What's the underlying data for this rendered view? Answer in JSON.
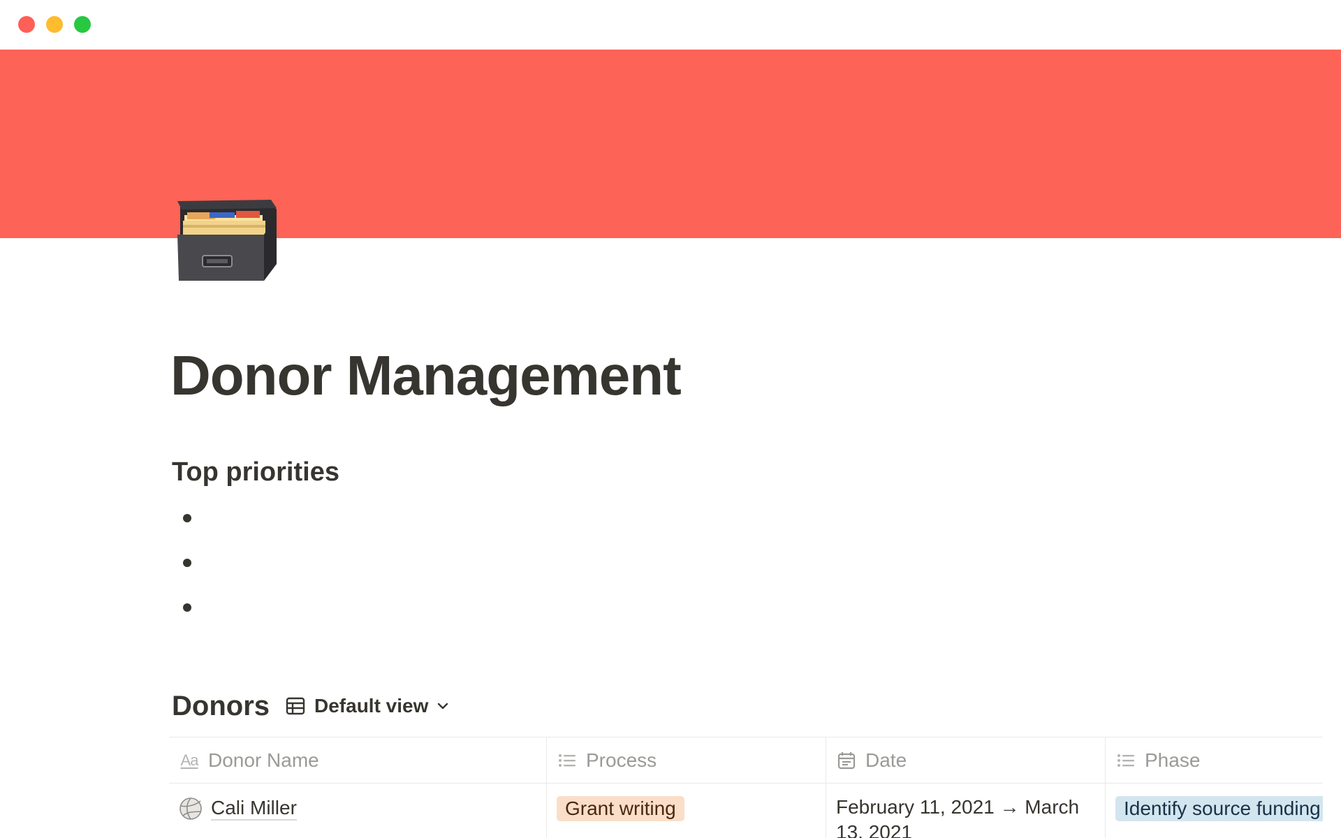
{
  "page": {
    "title": "Donor Management",
    "cover_color": "#fd6356",
    "icon": "card-file-box-icon"
  },
  "sections": {
    "priorities": {
      "heading": "Top priorities",
      "bullets": [
        "",
        "",
        ""
      ]
    }
  },
  "database": {
    "title": "Donors",
    "view_label": "Default view",
    "columns": [
      {
        "label": "Donor Name",
        "icon": "title-property-icon"
      },
      {
        "label": "Process",
        "icon": "list-property-icon"
      },
      {
        "label": "Date",
        "icon": "calendar-icon"
      },
      {
        "label": "Phase",
        "icon": "list-property-icon"
      }
    ],
    "rows": [
      {
        "name": "Cali Miller",
        "name_icon": "volleyball-icon",
        "process": "Grant writing",
        "date": "February 11, 2021 → March 13, 2021",
        "phase": "Identify source funding"
      }
    ]
  },
  "colors": {
    "text": "#37352f",
    "muted": "#9b9a97",
    "tag_orange": "#fadec9",
    "tag_blue": "#d3e5ef"
  }
}
